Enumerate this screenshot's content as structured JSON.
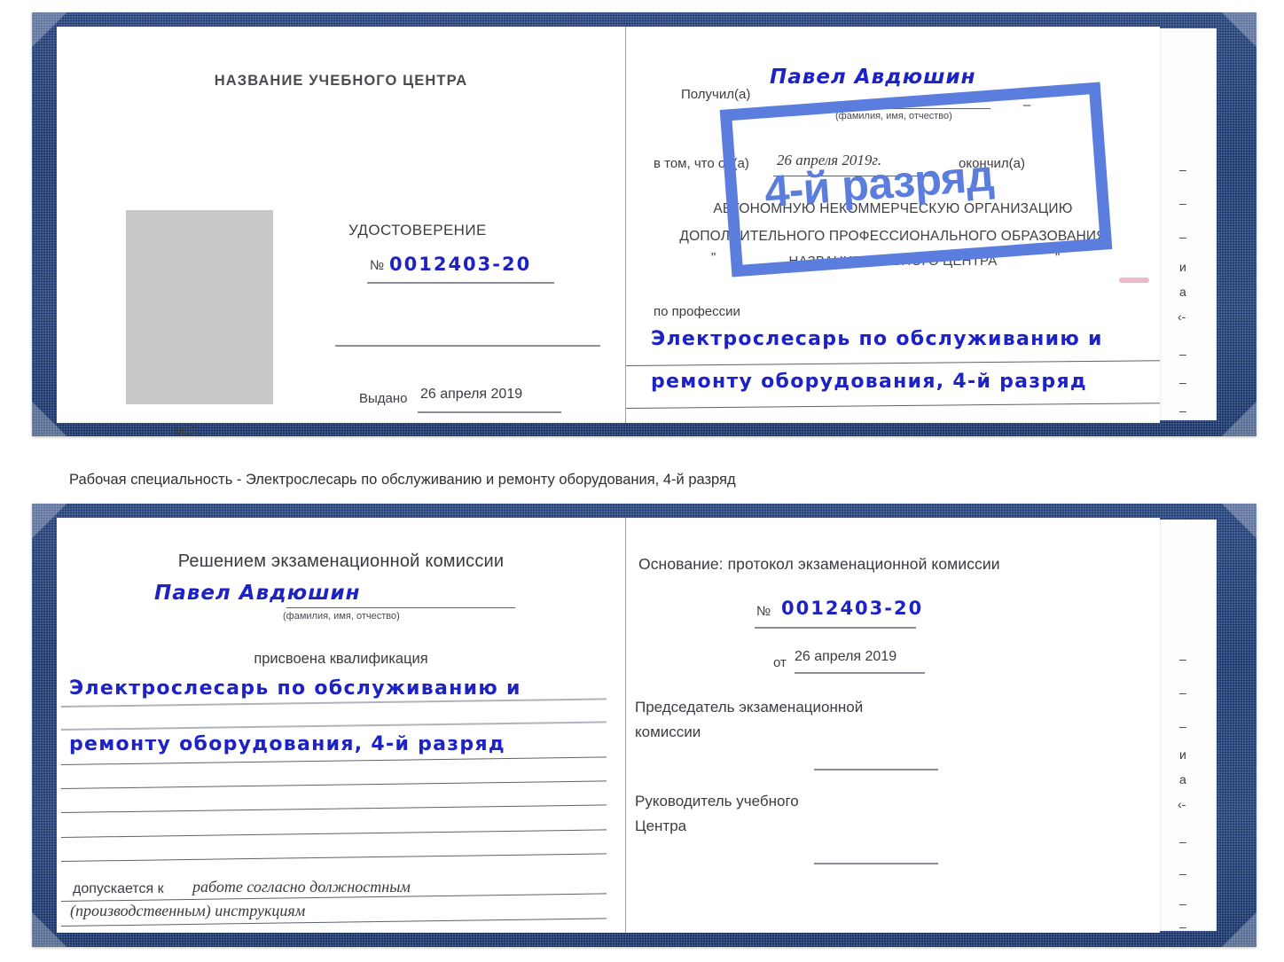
{
  "document": {
    "type": "certificate-booklet",
    "colors": {
      "cover_blue": "#23417c",
      "handwriting_blue": "#1d22c4",
      "stamp_blue": "#5b7ddd",
      "printed_gray": "#3c3c42",
      "rule_gray": "#8c9096",
      "photo_placeholder": "#c8c8c8"
    }
  },
  "caption": {
    "text": "Рабочая специальность - Электрослесарь по обслуживанию и ремонту оборудования, 4-й разряд"
  },
  "certificate_top": {
    "left_page": {
      "title": "НАЗВАНИЕ УЧЕБНОГО ЦЕНТРА",
      "doc_type": "УДОСТОВЕРЕНИЕ",
      "number_label": "№",
      "number_value": "0012403-20",
      "issued_label": "Выдано",
      "issued_value": "26 апреля 2019",
      "seal_label": "М.П.",
      "photo_alt": "photo-placeholder"
    },
    "right_page": {
      "received_label": "Получил(а)",
      "received_value": "Павел Авдюшин",
      "fio_hint": "(фамилия, имя, отчество)",
      "in_that_label": "в том, что он(а)",
      "completion_date": "26 апреля 2019г.",
      "finished_label": "окончил(а)",
      "org_line1": "АВТОНОМНУЮ НЕКОММЕРЧЕСКУЮ ОРГАНИЗАЦИЮ",
      "org_line2": "ДОПОЛНИТЕЛЬНОГО ПРОФЕССИОНАЛЬНОГО ОБРАЗОВАНИЯ",
      "org_quote_open": "\"",
      "org_name": "НАЗВАНИЕ УЧЕБНОГО ЦЕНТРА",
      "org_quote_close": "\"",
      "profession_label": "по профессии",
      "profession_line1": "Электрослесарь по обслуживанию и",
      "profession_line2": "ремонту оборудования, 4-й разряд",
      "dash": "–"
    },
    "stamp": {
      "text": "4-й разряд"
    },
    "behind_page_fragments": [
      "–",
      "–",
      "–",
      "и",
      "а",
      "‹-",
      "–",
      "–",
      "–"
    ]
  },
  "certificate_bottom": {
    "left_page": {
      "title": "Решением экзаменационной комиссии",
      "name_value": "Павел Авдюшин",
      "fio_hint": "(фамилия, имя, отчество)",
      "qualification_label": "присвоена квалификация",
      "qualification_line1": "Электрослесарь по обслуживанию и",
      "qualification_line2": "ремонту оборудования, 4-й разряд",
      "admitted_label": "допускается к",
      "admitted_value_line1": "работе согласно должностным",
      "admitted_value_line2": "(производственным) инструкциям"
    },
    "right_page": {
      "basis_label": "Основание: протокол экзаменационной комиссии",
      "number_label": "№",
      "number_value": "0012403-20",
      "from_label": "от",
      "from_value": "26 апреля 2019",
      "chairman_line1": "Председатель экзаменационной",
      "chairman_line2": "комиссии",
      "head_line1": "Руководитель учебного",
      "head_line2": "Центра"
    },
    "behind_page_fragments": [
      "–",
      "–",
      "–",
      "и",
      "а",
      "‹-",
      "–",
      "–",
      "–",
      "–"
    ]
  }
}
